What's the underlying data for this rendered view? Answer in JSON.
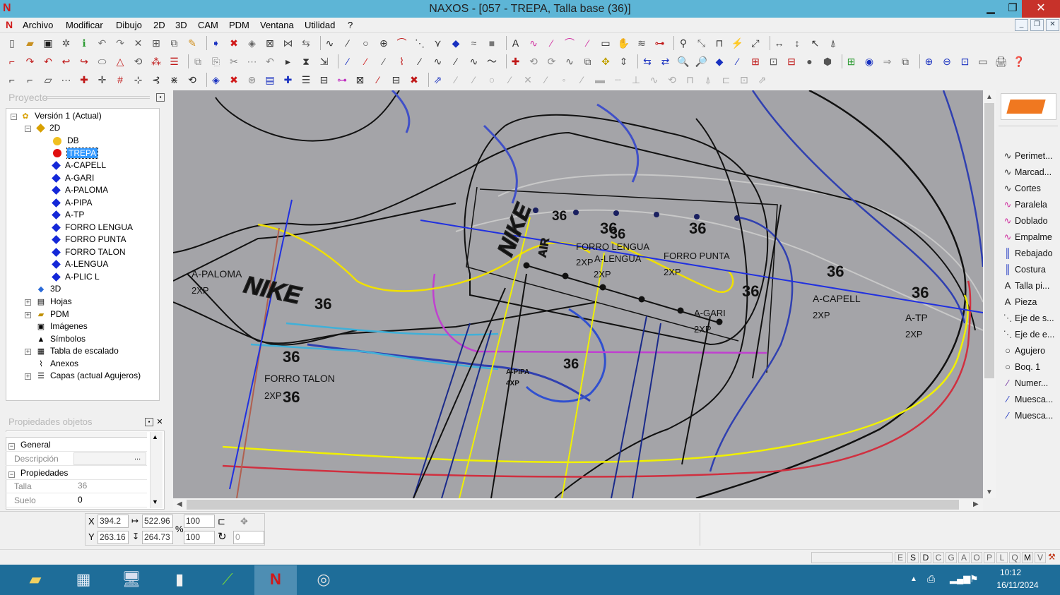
{
  "window": {
    "title": "NAXOS - [057 - TREPA, Talla base (36)]",
    "controls": {
      "minimize": "▁",
      "restore": "❐",
      "close": "✕"
    }
  },
  "menu": [
    "Archivo",
    "Modificar",
    "Dibujo",
    "2D",
    "3D",
    "CAM",
    "PDM",
    "Ventana",
    "Utilidad",
    "?"
  ],
  "project": {
    "title": "Proyecto",
    "root": "Versión 1 (Actual)",
    "folder_2d": "2D",
    "layers": [
      {
        "label": "DB",
        "color": "#f0c020",
        "shape": "dot"
      },
      {
        "label": "TREPA",
        "color": "#e01010",
        "shape": "dot",
        "selected": true
      },
      {
        "label": "A-CAPELL",
        "color": "#1428d8",
        "shape": "diamond"
      },
      {
        "label": "A-GARI",
        "color": "#1428d8",
        "shape": "diamond"
      },
      {
        "label": "A-PALOMA",
        "color": "#1428d8",
        "shape": "diamond"
      },
      {
        "label": "A-PIPA",
        "color": "#1428d8",
        "shape": "diamond"
      },
      {
        "label": "A-TP",
        "color": "#1428d8",
        "shape": "diamond"
      },
      {
        "label": "FORRO LENGUA",
        "color": "#1428d8",
        "shape": "diamond"
      },
      {
        "label": "FORRO PUNTA",
        "color": "#1428d8",
        "shape": "diamond"
      },
      {
        "label": "FORRO TALON",
        "color": "#1428d8",
        "shape": "diamond"
      },
      {
        "label": "A-LENGUA",
        "color": "#1428d8",
        "shape": "diamond"
      },
      {
        "label": "A-PLIC L",
        "color": "#1428d8",
        "shape": "diamond"
      }
    ],
    "other_nodes": [
      "3D",
      "Hojas",
      "PDM",
      "Imágenes",
      "Símbolos",
      "Tabla de escalado",
      "Anexos",
      "Capas (actual Agujeros)"
    ]
  },
  "properties": {
    "title": "Propiedades objetos",
    "section_general": "General",
    "desc_label": "Descripción",
    "desc_button": "...",
    "section_props": "Propiedades",
    "talla_label": "Talla",
    "talla_value": "36",
    "suelo_label": "Suelo",
    "suelo_value": "0"
  },
  "canvas_labels": {
    "paloma": "A-PALOMA",
    "paloma_qty": "2XP",
    "size": "36",
    "forro_talon": "FORRO TALON",
    "forro_talon_qty": "2XP",
    "forro_lengua": "FORRO LENGUA",
    "a_lengua": "A-LENGUA",
    "forro_punta": "FORRO PUNTA",
    "a_capell": "A-CAPELL",
    "a_tp": "A-TP",
    "a_gari": "A-GARI",
    "a_pipa": "A-PIPA",
    "a_pipa_qty": "4XP",
    "qty_2xp": "2XP",
    "brand": "NIKE",
    "air": "AIR"
  },
  "right_tools": [
    "Perimet...",
    "Marcad...",
    "Cortes",
    "Paralela",
    "Doblado",
    "Empalme",
    "Rebajado",
    "Costura",
    "Talla pi...",
    "Pieza",
    "Eje de s...",
    "Eje de e...",
    "Agujero",
    "Boq. 1",
    "Numer...",
    "Muesca...",
    "Muesca..."
  ],
  "coords": {
    "x_label": "X",
    "y_label": "Y",
    "x": "394.2",
    "y": "263.16",
    "w": "522.96",
    "h": "264.73",
    "pct_label": "%",
    "sx": "100",
    "sy": "100",
    "angle": "0"
  },
  "status_flags": [
    "E",
    "S",
    "D",
    "C",
    "G",
    "A",
    "O",
    "P",
    "L",
    "Q",
    "M",
    "V"
  ],
  "taskbar": {
    "time": "10:12",
    "date": "16/11/2024"
  }
}
